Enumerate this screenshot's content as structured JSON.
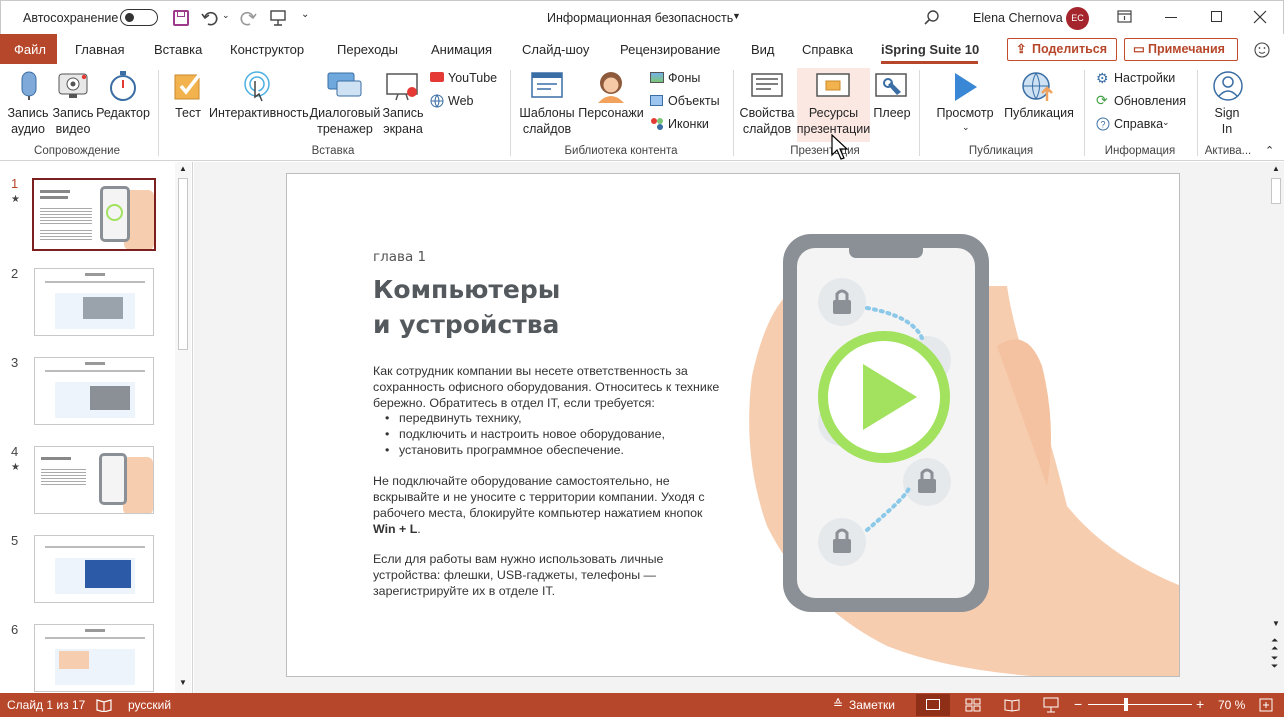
{
  "titlebar": {
    "autosave_label": "Автосохранение",
    "autosave_state": "Откл.",
    "doc_title": "Информационная безопасность",
    "user_name": "Elena Chernova",
    "user_initials": "EC"
  },
  "tabs": [
    "Файл",
    "Главная",
    "Вставка",
    "Конструктор",
    "Переходы",
    "Анимация",
    "Слайд-шоу",
    "Рецензирование",
    "Вид",
    "Справка",
    "iSpring Suite 10"
  ],
  "share_label": "Поделиться",
  "comments_label": "Примечания",
  "ribbon": {
    "audio": "Запись\nаудио",
    "video": "Запись\nвидео",
    "editor": "Редактор",
    "group1": "Сопровождение",
    "quiz": "Тест",
    "interactivity": "Интерактивность",
    "dialog": "Диалоговый\nтренажер",
    "screen": "Запись\nэкрана",
    "youtube": "YouTube",
    "web": "Web",
    "group2": "Вставка",
    "templates": "Шаблоны\nслайдов",
    "characters": "Персонажи",
    "backgrounds": "Фоны",
    "objects": "Объекты",
    "icons": "Иконки",
    "group3": "Библиотека контента",
    "props": "Свойства\nслайдов",
    "resources": "Ресурсы\nпрезентации",
    "player": "Плеер",
    "group4": "Презентация",
    "preview": "Просмотр",
    "publish": "Публикация",
    "group5": "Публикация",
    "settings": "Настройки",
    "updates": "Обновления",
    "help": "Справка",
    "group6": "Информация",
    "signin": "Sign\nIn",
    "group7": "Актива..."
  },
  "thumbnails": [
    {
      "num": "1",
      "star": "★"
    },
    {
      "num": "2",
      "star": ""
    },
    {
      "num": "3",
      "star": ""
    },
    {
      "num": "4",
      "star": "★"
    },
    {
      "num": "5",
      "star": ""
    },
    {
      "num": "6",
      "star": ""
    }
  ],
  "slide": {
    "chapter": "глава 1",
    "title_line1": "Компьютеры",
    "title_line2": "и устройства",
    "p1": "Как сотрудник компании вы несете ответственность за сохранность офисного оборудования. Относитесь к технике бережно. Обратитесь в отдел IT, если требуется:",
    "bullets": [
      "передвинуть технику,",
      "подключить и настроить новое оборудование,",
      "установить программное обеспечение."
    ],
    "p2_pre": "Не подключайте оборудование самостоятельно,  не вскрывайте и не уносите с территории компании. Уходя с рабочего места, блокируйте компьютер нажатием кнопок ",
    "p2_bold": "Win + L",
    "p2_post": ".",
    "p3": "Если для работы вам нужно использовать личные устройства: флешки, USB-гаджеты, телефоны — зарегистрируйте их в отделе IT."
  },
  "status": {
    "slide_info": "Слайд 1 из 17",
    "language": "русский",
    "notes": "Заметки",
    "zoom": "70 %"
  },
  "colors": {
    "accent": "#b7472a",
    "play_green": "#a2e25f"
  }
}
